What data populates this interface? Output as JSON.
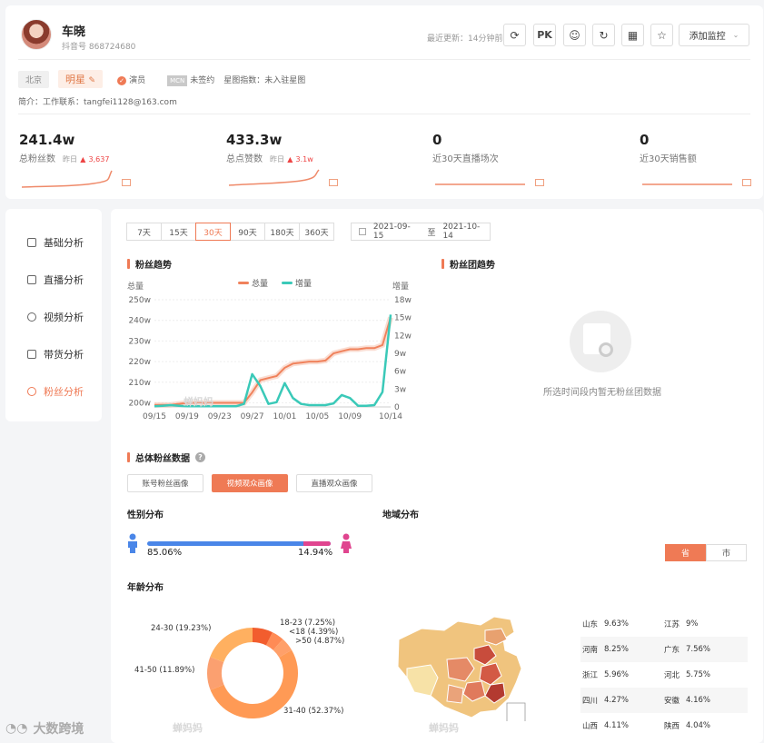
{
  "profile": {
    "name": "车晓",
    "douyin_id": "抖音号 868724680",
    "last_update": "最近更新：14分钟前",
    "monitor_label": "添加监控",
    "pk_label": "PK",
    "location": "北京",
    "star_tag": "明星",
    "verified": "演员",
    "mcn_badge": "MCN",
    "mcn_status": "未签约",
    "star_index": "星图指数：未入驻星图",
    "bio": "简介：工作联系：tangfei1128@163.com"
  },
  "stats": [
    {
      "value": "241.4w",
      "label": "总粉丝数",
      "yday_label": "昨日",
      "yday_value": "3,637"
    },
    {
      "value": "433.3w",
      "label": "总点赞数",
      "yday_label": "昨日",
      "yday_value": "3.1w"
    },
    {
      "value": "0",
      "label": "近30天直播场次"
    },
    {
      "value": "0",
      "label": "近30天销售额"
    }
  ],
  "sidebar": {
    "items": [
      {
        "label": "基础分析",
        "icon": "bar-chart-icon"
      },
      {
        "label": "直播分析",
        "icon": "live-icon"
      },
      {
        "label": "视频分析",
        "icon": "play-icon"
      },
      {
        "label": "带货分析",
        "icon": "shopping-bag-icon"
      },
      {
        "label": "粉丝分析",
        "icon": "user-icon",
        "active": true
      }
    ]
  },
  "filters": {
    "ranges": [
      "7天",
      "15天",
      "30天",
      "90天",
      "180天",
      "360天"
    ],
    "selected": "30天",
    "date_start": "2021-09-15",
    "date_sep": "至",
    "date_end": "2021-10-14"
  },
  "sections": {
    "fan_trend": "粉丝趋势",
    "fan_group_trend": "粉丝团趋势",
    "empty_text": "所选时间段内暂无粉丝团数据",
    "overall": "总体粉丝数据",
    "help": "?",
    "gender": "性别分布",
    "region": "地域分布",
    "age": "年龄分布"
  },
  "view_tabs": [
    "账号粉丝画像",
    "视频观众画像",
    "直播观众画像"
  ],
  "view_selected": 1,
  "gender": {
    "male": "85.06%",
    "female": "14.94%",
    "female_fraction": 0.1494
  },
  "region_tabs": [
    "省",
    "市"
  ],
  "region_selected": 0,
  "regions": [
    [
      "山东",
      "9.63%",
      "江苏",
      "9%"
    ],
    [
      "河南",
      "8.25%",
      "广东",
      "7.56%"
    ],
    [
      "浙江",
      "5.96%",
      "河北",
      "5.75%"
    ],
    [
      "四川",
      "4.27%",
      "安徽",
      "4.16%"
    ],
    [
      "山西",
      "4.11%",
      "陕西",
      "4.04%"
    ]
  ],
  "watermark": "蝉妈妈",
  "footer_logo": "大数跨境",
  "colors": {
    "accent": "#ef7a55",
    "total_line": "#f0825c",
    "increment_line": "#3ac9b8",
    "male": "#4a86e8",
    "female": "#e0458f"
  },
  "chart_data": [
    {
      "type": "line",
      "title": "粉丝趋势",
      "x": [
        "09/15",
        "09/16",
        "09/17",
        "09/18",
        "09/19",
        "09/20",
        "09/21",
        "09/22",
        "09/23",
        "09/24",
        "09/25",
        "09/26",
        "09/27",
        "09/28",
        "09/29",
        "09/30",
        "10/01",
        "10/02",
        "10/03",
        "10/04",
        "10/05",
        "10/06",
        "10/07",
        "10/08",
        "10/09",
        "10/10",
        "10/11",
        "10/12",
        "10/13",
        "10/14"
      ],
      "x_ticks": [
        "09/15",
        "09/19",
        "09/23",
        "09/27",
        "10/01",
        "10/05",
        "10/09",
        "10/14"
      ],
      "legend": [
        "总量",
        "增量"
      ],
      "ylabel_left": "总量",
      "ylabel_right": "增量",
      "yticks_left": [
        "200w",
        "210w",
        "220w",
        "230w",
        "240w",
        "250w"
      ],
      "yticks_right": [
        "0",
        "3w",
        "6w",
        "9w",
        "12w",
        "15w",
        "18w"
      ],
      "ylim_left": [
        198,
        250
      ],
      "ylim_right": [
        0,
        18
      ],
      "series": [
        {
          "name": "总量",
          "axis": "left",
          "values": [
            199,
            199,
            199,
            199.5,
            200,
            200,
            200,
            200,
            200,
            200,
            200,
            200,
            205,
            211,
            212,
            213,
            217,
            219,
            219.5,
            220,
            220,
            220.5,
            224,
            225,
            226,
            226,
            226.5,
            226.5,
            228,
            241.4
          ]
        },
        {
          "name": "增量",
          "axis": "right",
          "values": [
            0.1,
            0.2,
            0.3,
            0.2,
            0.1,
            0.1,
            0.1,
            0.1,
            0.1,
            0.1,
            0.1,
            0.5,
            5.5,
            3.5,
            0.5,
            0.8,
            4.0,
            1.5,
            0.5,
            0.3,
            0.3,
            0.3,
            0.6,
            2.0,
            1.5,
            0.2,
            0.2,
            0.3,
            2.5,
            15.5
          ]
        }
      ]
    },
    {
      "type": "pie",
      "title": "年龄分布",
      "categories": [
        "18-23",
        "<18",
        ">50",
        "31-40",
        "41-50",
        "24-30"
      ],
      "labels": [
        "18-23 (7.25%)",
        "<18 (4.39%)",
        ">50 (4.87%)",
        "31-40 (52.37%)",
        "41-50 (11.89%)",
        "24-30 (19.23%)"
      ],
      "values": [
        7.25,
        4.39,
        4.87,
        52.37,
        11.89,
        19.23
      ]
    }
  ]
}
